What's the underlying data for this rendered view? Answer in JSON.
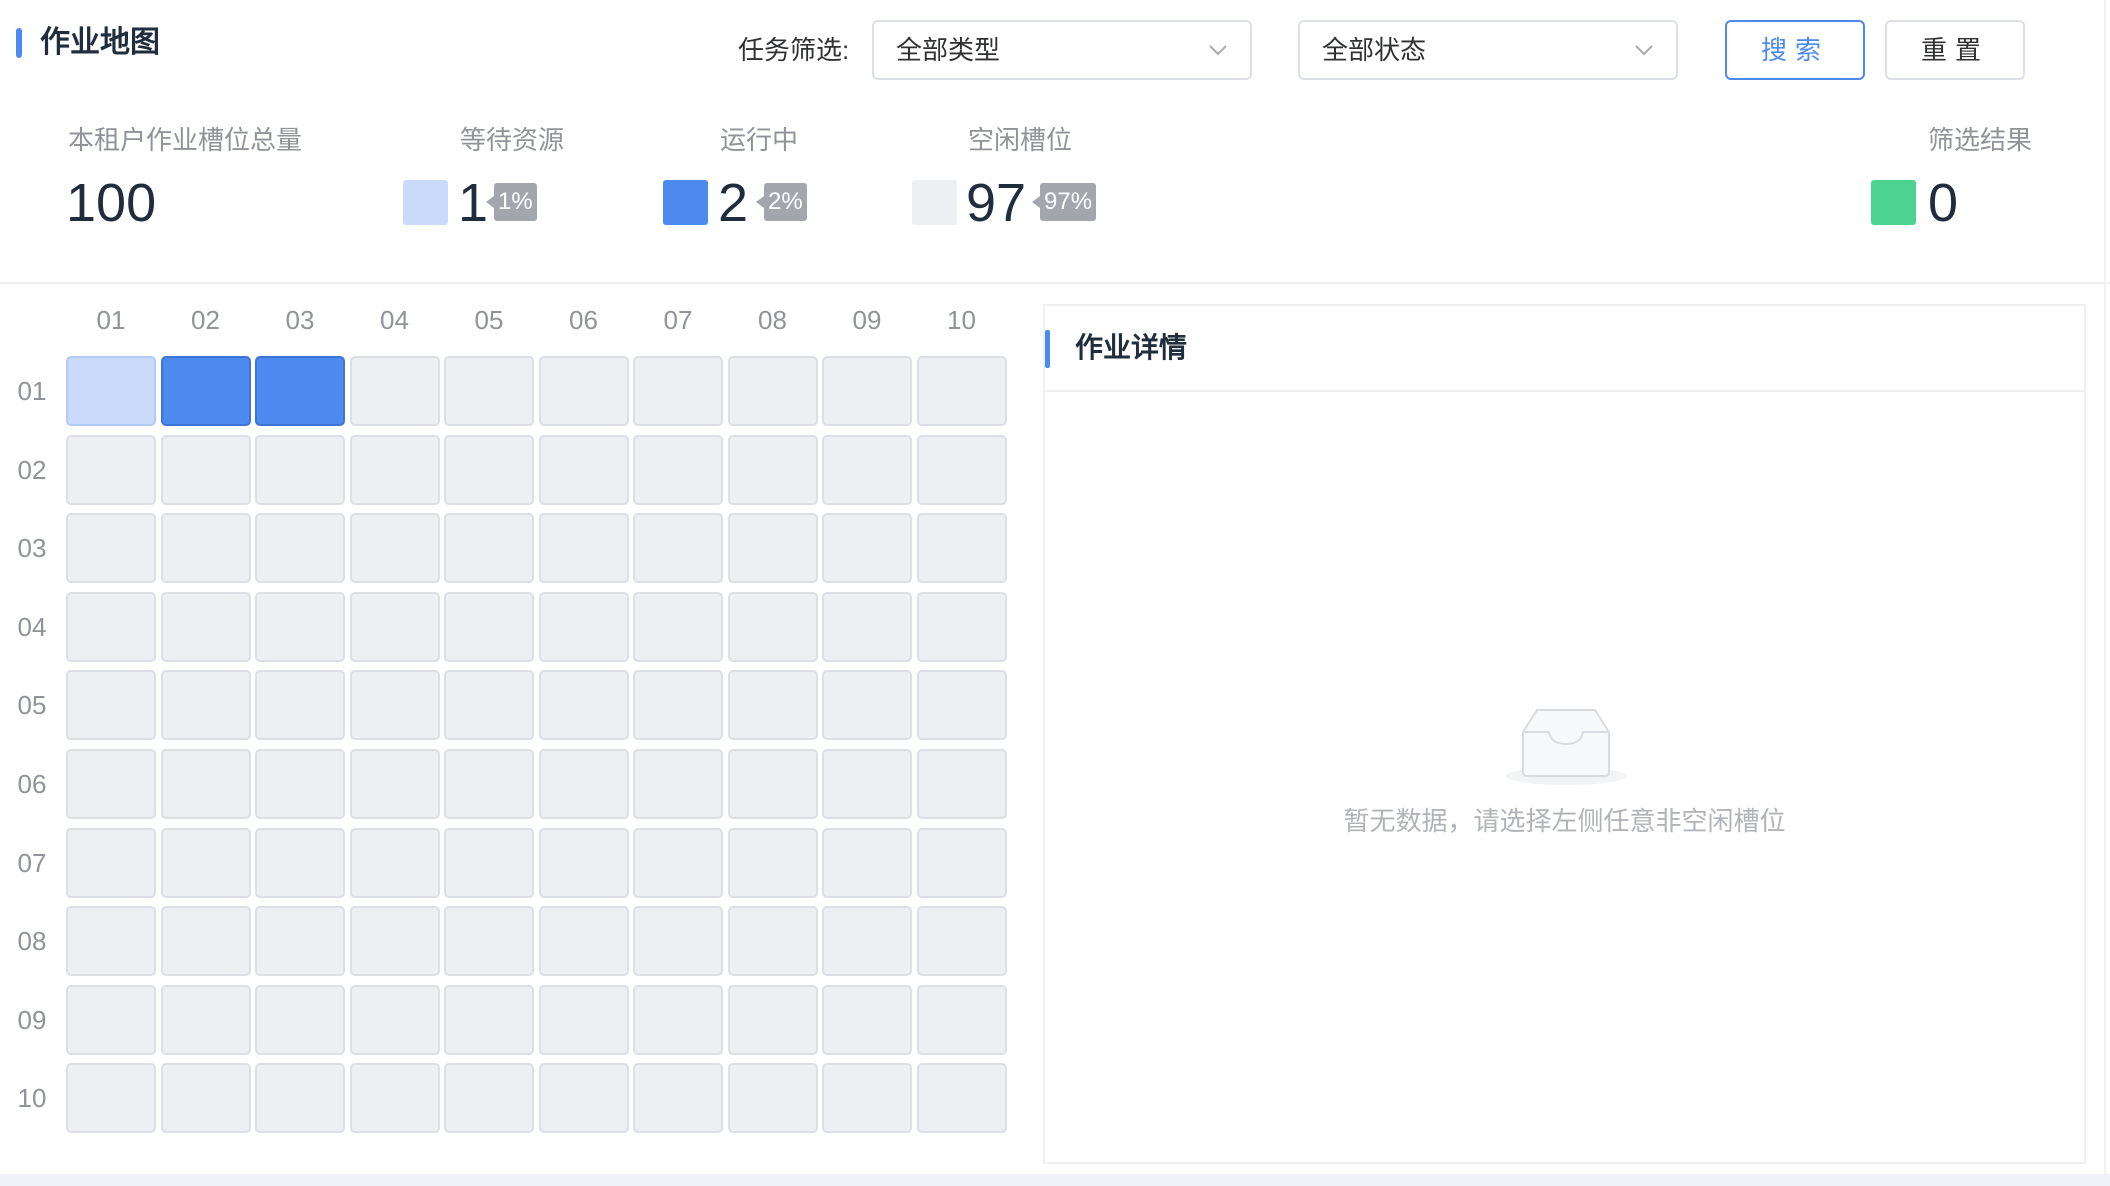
{
  "header": {
    "title": "作业地图"
  },
  "filters": {
    "label": "任务筛选:",
    "type_select": {
      "value": "全部类型"
    },
    "status_select": {
      "value": "全部状态"
    },
    "search_label": "搜索",
    "reset_label": "重置"
  },
  "stats": {
    "total": {
      "label": "本租户作业槽位总量",
      "value": "100"
    },
    "waiting": {
      "label": "等待资源",
      "value": "1",
      "percent": "1%",
      "color": "#c9dafa"
    },
    "running": {
      "label": "运行中",
      "value": "2",
      "percent": "2%",
      "color": "#4d8af0"
    },
    "idle": {
      "label": "空闲槽位",
      "value": "97",
      "percent": "97%",
      "color": "#edeff2"
    },
    "filtered": {
      "label": "筛选结果",
      "value": "0",
      "color": "#4cd38f"
    }
  },
  "grid": {
    "columns": [
      "01",
      "02",
      "03",
      "04",
      "05",
      "06",
      "07",
      "08",
      "09",
      "10"
    ],
    "rows": [
      "01",
      "02",
      "03",
      "04",
      "05",
      "06",
      "07",
      "08",
      "09",
      "10"
    ],
    "states": [
      [
        "waiting",
        "running",
        "running",
        "idle",
        "idle",
        "idle",
        "idle",
        "idle",
        "idle",
        "idle"
      ],
      [
        "idle",
        "idle",
        "idle",
        "idle",
        "idle",
        "idle",
        "idle",
        "idle",
        "idle",
        "idle"
      ],
      [
        "idle",
        "idle",
        "idle",
        "idle",
        "idle",
        "idle",
        "idle",
        "idle",
        "idle",
        "idle"
      ],
      [
        "idle",
        "idle",
        "idle",
        "idle",
        "idle",
        "idle",
        "idle",
        "idle",
        "idle",
        "idle"
      ],
      [
        "idle",
        "idle",
        "idle",
        "idle",
        "idle",
        "idle",
        "idle",
        "idle",
        "idle",
        "idle"
      ],
      [
        "idle",
        "idle",
        "idle",
        "idle",
        "idle",
        "idle",
        "idle",
        "idle",
        "idle",
        "idle"
      ],
      [
        "idle",
        "idle",
        "idle",
        "idle",
        "idle",
        "idle",
        "idle",
        "idle",
        "idle",
        "idle"
      ],
      [
        "idle",
        "idle",
        "idle",
        "idle",
        "idle",
        "idle",
        "idle",
        "idle",
        "idle",
        "idle"
      ],
      [
        "idle",
        "idle",
        "idle",
        "idle",
        "idle",
        "idle",
        "idle",
        "idle",
        "idle",
        "idle"
      ],
      [
        "idle",
        "idle",
        "idle",
        "idle",
        "idle",
        "idle",
        "idle",
        "idle",
        "idle",
        "idle"
      ]
    ]
  },
  "detail": {
    "title": "作业详情",
    "empty_icon": "empty-inbox-icon",
    "empty_text": "暂无数据，请选择左侧任意非空闲槽位"
  }
}
